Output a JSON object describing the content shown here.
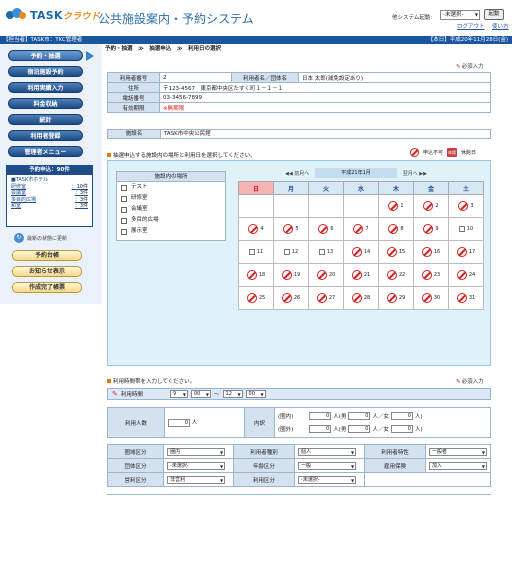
{
  "header": {
    "logo_task": "TASK",
    "logo_cloud": "クラウド",
    "app_title": "公共施設案内・予約システム",
    "sys_launch_label": "他システム起動:",
    "sys_select_value": "-未選択-",
    "launch_button": "起動",
    "logout": "ログアウト",
    "help": "使い方"
  },
  "topbar": {
    "left": "【担当者】TASK市：TKC管理者",
    "right": "【本日】平成20年11月28日(金)"
  },
  "sidebar": {
    "items": [
      {
        "label": "予約・抽選"
      },
      {
        "label": "宿泊施設予約"
      },
      {
        "label": "利用実績入力"
      },
      {
        "label": "料金収納"
      },
      {
        "label": "統計"
      },
      {
        "label": "利用者登録"
      },
      {
        "label": "管理者メニュー"
      }
    ],
    "pending_title": "予約申込：90件",
    "pending_hotel": "■TASK市ホテル",
    "pending_rows": [
      {
        "name": "研修室",
        "count": "：10件"
      },
      {
        "name": "会議室",
        "count": "：3件"
      },
      {
        "name": "多目的広場",
        "count": "：3件"
      },
      {
        "name": "和室",
        "count": "：3件"
      }
    ],
    "refresh_label": "最新の状態に更新",
    "buttons": [
      {
        "label": "予約台帳"
      },
      {
        "label": "お知らせ表示"
      },
      {
        "label": "作成完了帳票"
      }
    ]
  },
  "breadcrumb": "予約・抽選　≫　抽選申込　≫　利用日の選択",
  "mandatory_label": "必須入力",
  "info": {
    "user_no_label": "利用者番号",
    "user_no_value": "2",
    "user_name_label": "利用者名／団体名",
    "user_name_value": "日本 太郎(減免設定あり)",
    "address_label": "住所",
    "address_value": "〒123-4567　東京都中央区たすく町１－１－１",
    "phone_label": "電話番号",
    "phone_value": "03-3456-7899",
    "expiry_label": "有効期限",
    "expiry_value": "※無期限",
    "facility_label": "施設名",
    "facility_value": "TASK市中央公民館"
  },
  "calendar_section": {
    "instruction": "抽選申込する施設内の場所と利用日を選択してください。",
    "legend_unavailable": "申込不可",
    "legend_holiday_icon": "休館",
    "legend_holiday": "休館日",
    "place_header": "施設内の場所",
    "places": [
      "テスト",
      "研修室",
      "会議室",
      "多目的広場",
      "展示室"
    ],
    "prev_month": "◀◀ 前月へ",
    "current_month": "平成21年1月",
    "next_month": "翌月へ ▶▶",
    "weekdays": [
      "日",
      "月",
      "火",
      "水",
      "木",
      "金",
      "土"
    ],
    "weeks": [
      [
        {
          "d": "",
          "t": "blank"
        },
        {
          "d": "",
          "t": "blank"
        },
        {
          "d": "",
          "t": "blank"
        },
        {
          "d": "",
          "t": "blank"
        },
        {
          "d": "1",
          "t": "no"
        },
        {
          "d": "2",
          "t": "no"
        },
        {
          "d": "3",
          "t": "no"
        }
      ],
      [
        {
          "d": "4",
          "t": "no"
        },
        {
          "d": "5",
          "t": "no"
        },
        {
          "d": "6",
          "t": "no"
        },
        {
          "d": "7",
          "t": "no"
        },
        {
          "d": "8",
          "t": "no"
        },
        {
          "d": "9",
          "t": "no"
        },
        {
          "d": "10",
          "t": "cb"
        }
      ],
      [
        {
          "d": "11",
          "t": "cb"
        },
        {
          "d": "12",
          "t": "cb"
        },
        {
          "d": "13",
          "t": "cb"
        },
        {
          "d": "14",
          "t": "no"
        },
        {
          "d": "15",
          "t": "no"
        },
        {
          "d": "16",
          "t": "no"
        },
        {
          "d": "17",
          "t": "no"
        }
      ],
      [
        {
          "d": "18",
          "t": "no"
        },
        {
          "d": "19",
          "t": "no"
        },
        {
          "d": "20",
          "t": "no"
        },
        {
          "d": "21",
          "t": "no"
        },
        {
          "d": "22",
          "t": "no"
        },
        {
          "d": "23",
          "t": "no"
        },
        {
          "d": "24",
          "t": "no"
        }
      ],
      [
        {
          "d": "25",
          "t": "no"
        },
        {
          "d": "26",
          "t": "no"
        },
        {
          "d": "27",
          "t": "no"
        },
        {
          "d": "28",
          "t": "no"
        },
        {
          "d": "29",
          "t": "no"
        },
        {
          "d": "30",
          "t": "no"
        },
        {
          "d": "31",
          "t": "no"
        }
      ]
    ]
  },
  "usage_section": {
    "instruction": "利用時間帯を入力してください。",
    "time_label": "利用時間",
    "start_hour": "9",
    "start_min": "00",
    "tilde": "～",
    "end_hour": "12",
    "end_min": "00",
    "people_label": "利用人数",
    "people_value": "0",
    "people_unit": "人",
    "breakdown_label": "内訳",
    "in_city": "(圏内)",
    "out_city": "(圏外)",
    "in_total": "0",
    "in_male": "0",
    "in_female": "0",
    "in_other": "0",
    "out_total": "0",
    "out_male": "0",
    "out_female": "0",
    "out_other": "0",
    "person_male": "人(男",
    "person_female": "人／女",
    "person_other": "人／他",
    "close_paren": "人)"
  },
  "classification": {
    "rows": [
      [
        {
          "label": "圏域区分",
          "value": "圏内"
        },
        {
          "label": "利用者種別",
          "value": "個人"
        },
        {
          "label": "利用者特性",
          "value": "一般者"
        }
      ],
      [
        {
          "label": "団体区分",
          "value": "-未選択-"
        },
        {
          "label": "年齢区分",
          "value": "一般"
        },
        {
          "label": "雇用保険",
          "value": "加入"
        }
      ],
      [
        {
          "label": "営利区分",
          "value": "非営利"
        },
        {
          "label": "利用区分",
          "value": "-未選択-"
        },
        {
          "label": "",
          "value": ""
        }
      ]
    ]
  },
  "colors": {
    "topbar": "#1a56a0",
    "nav_button": "#1e4d8a",
    "calendar_bg": "#dff2fa",
    "sunday_header": "#f6b3b3",
    "unavailable": "#d02020"
  }
}
